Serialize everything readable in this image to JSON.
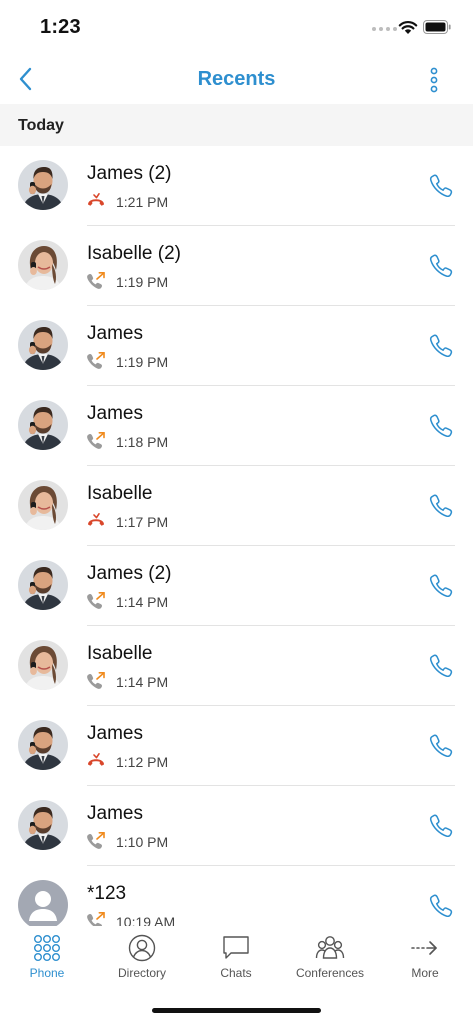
{
  "status_bar": {
    "time": "1:23"
  },
  "nav": {
    "title": "Recents"
  },
  "section": {
    "label": "Today"
  },
  "colors": {
    "accent": "#2e8fcf",
    "missed": "#d9472b",
    "outgoing_arrow": "#f08a1c",
    "handset_gray": "#9b9b9b"
  },
  "calls": [
    {
      "name": "James (2)",
      "time": "1:21 PM",
      "type": "missed",
      "avatar": "james"
    },
    {
      "name": "Isabelle (2)",
      "time": "1:19 PM",
      "type": "outgoing",
      "avatar": "isabelle"
    },
    {
      "name": "James",
      "time": "1:19 PM",
      "type": "outgoing",
      "avatar": "james"
    },
    {
      "name": "James",
      "time": "1:18 PM",
      "type": "outgoing",
      "avatar": "james"
    },
    {
      "name": "Isabelle",
      "time": "1:17 PM",
      "type": "missed",
      "avatar": "isabelle"
    },
    {
      "name": "James (2)",
      "time": "1:14 PM",
      "type": "outgoing",
      "avatar": "james"
    },
    {
      "name": "Isabelle",
      "time": "1:14 PM",
      "type": "outgoing",
      "avatar": "isabelle"
    },
    {
      "name": "James",
      "time": "1:12 PM",
      "type": "missed",
      "avatar": "james"
    },
    {
      "name": "James",
      "time": "1:10 PM",
      "type": "outgoing",
      "avatar": "james"
    },
    {
      "name": "*123",
      "time": "10:19 AM",
      "type": "outgoing",
      "avatar": "placeholder"
    }
  ],
  "tabs": [
    {
      "label": "Phone",
      "icon": "dialpad-icon",
      "active": true
    },
    {
      "label": "Directory",
      "icon": "person-icon",
      "active": false
    },
    {
      "label": "Chats",
      "icon": "chat-bubble-icon",
      "active": false
    },
    {
      "label": "Conferences",
      "icon": "group-icon",
      "active": false
    },
    {
      "label": "More",
      "icon": "arrow-right-icon",
      "active": false
    }
  ]
}
